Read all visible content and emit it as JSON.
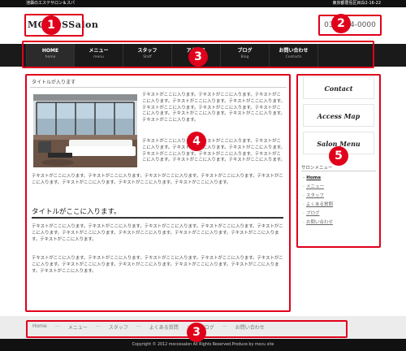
{
  "topbar": {
    "left_text": "池袋のエステサロン＆スパ",
    "right_text": "東京都豊島区目白2-16-22"
  },
  "header": {
    "logo": "MOCOSSalon",
    "phone": "03-1234-0000"
  },
  "nav": {
    "items": [
      {
        "jp": "HOME",
        "en": "home"
      },
      {
        "jp": "メニュー",
        "en": "menu"
      },
      {
        "jp": "スタッフ",
        "en": "Staff"
      },
      {
        "jp": "アクセス",
        "en": "Access"
      },
      {
        "jp": "ブログ",
        "en": "Blog"
      },
      {
        "jp": "お問い合わせ",
        "en": "Contacts"
      }
    ]
  },
  "main": {
    "breadcrumb": "タイトルが入ります",
    "para1": "テキストがここに入ります。テキストがここに入ります。テキストがここに入ります。テキストがここに入ります。テキストがここに入ります。テキストがここに入ります。テキストがここに入ります。テキストがここに入ります。テキストがここに入ります。テキストがここに入ります。テキストがここに入ります。",
    "para2": "テキストがここに入ります。テキストがここに入ります。テキストがここに入ります。テキストがここに入ります。テキストがここに入ります。テキストがここに入ります。テキストがここに入ります。テキストがここに入ります。テキストがここに入ります。テキストがここに入ります。",
    "para3": "テキストがここに入ります。テキストがここに入ります。テキストがここに入ります。テキストがここに入ります。テキストがここに入ります。テキストがここに入ります。テキストがここに入ります。テキストがここに入ります。",
    "heading": "タイトルがここに入ります。",
    "para4": "テキストがここに入ります。テキストがここに入ります。テキストがここに入ります。テキストがここに入ります。テキストがここに入ります。テキストがここに入ります。テキストがここに入ります。テキストがここに入ります。テキストがここに入ります。テキストがここに入ります。",
    "para5": "テキストがここに入ります。テキストがここに入ります。テキストがここに入ります。テキストがここに入ります。テキストがここに入ります。テキストがここに入ります。テキストがここに入ります。テキストがここに入ります。テキストがここに入ります。テキストがここに入ります。"
  },
  "side": {
    "buttons": [
      "Contact",
      "Access Map",
      "Salon Menu"
    ],
    "menu_title": "サロンメニュー",
    "menu_items": [
      "Home",
      "メニュー",
      "スタッフ",
      "よくある質問",
      "ブログ",
      "お問い合わせ"
    ]
  },
  "footer": {
    "nav_items": [
      "Home",
      "メニュー",
      "スタッフ",
      "よくある質問",
      "ブログ",
      "お問い合わせ"
    ],
    "copyright": "Copyright © 2012 mocossalon All Rights Reserved.Produce by mocu site"
  },
  "annotations": [
    "1",
    "2",
    "3",
    "4",
    "5",
    "3"
  ],
  "colors": {
    "annotation": "#e0001b",
    "navbar": "#1a1a1a",
    "topbar": "#111111"
  }
}
